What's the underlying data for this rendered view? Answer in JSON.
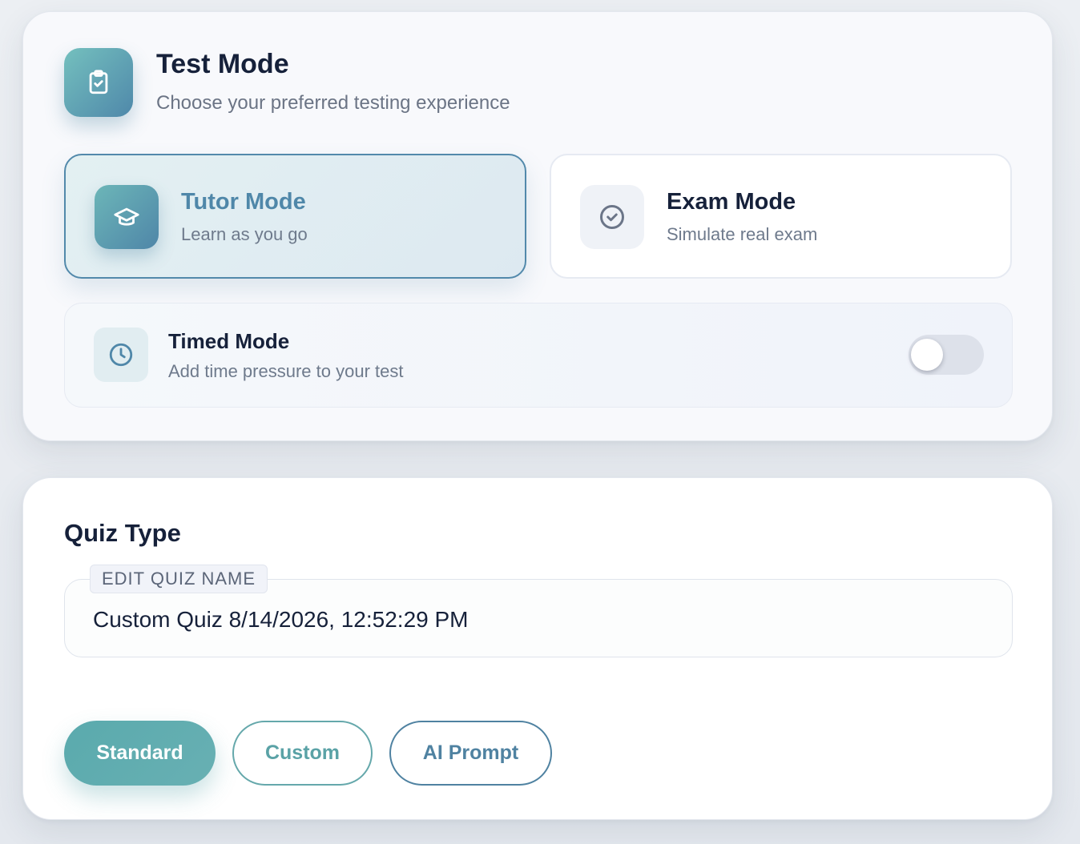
{
  "test_mode": {
    "title": "Test Mode",
    "subtitle": "Choose your preferred testing experience",
    "icon": "clipboard-check-icon",
    "modes": [
      {
        "id": "tutor",
        "title": "Tutor Mode",
        "subtitle": "Learn as you go",
        "icon": "graduation-cap-icon",
        "selected": true
      },
      {
        "id": "exam",
        "title": "Exam Mode",
        "subtitle": "Simulate real exam",
        "icon": "check-circle-icon",
        "selected": false
      }
    ],
    "timed": {
      "title": "Timed Mode",
      "subtitle": "Add time pressure to your test",
      "icon": "clock-icon",
      "enabled": false
    }
  },
  "quiz_type": {
    "title": "Quiz Type",
    "name_label": "EDIT QUIZ NAME",
    "name_value": "Custom Quiz 8/14/2026, 12:52:29 PM",
    "options": [
      "Standard",
      "Custom",
      "AI Prompt"
    ],
    "selected": "Standard"
  },
  "colors": {
    "accent_teal": "#5aaaad",
    "accent_blue": "#4f87a9",
    "text_dark": "#16213a",
    "text_muted": "#6e7a8c"
  }
}
